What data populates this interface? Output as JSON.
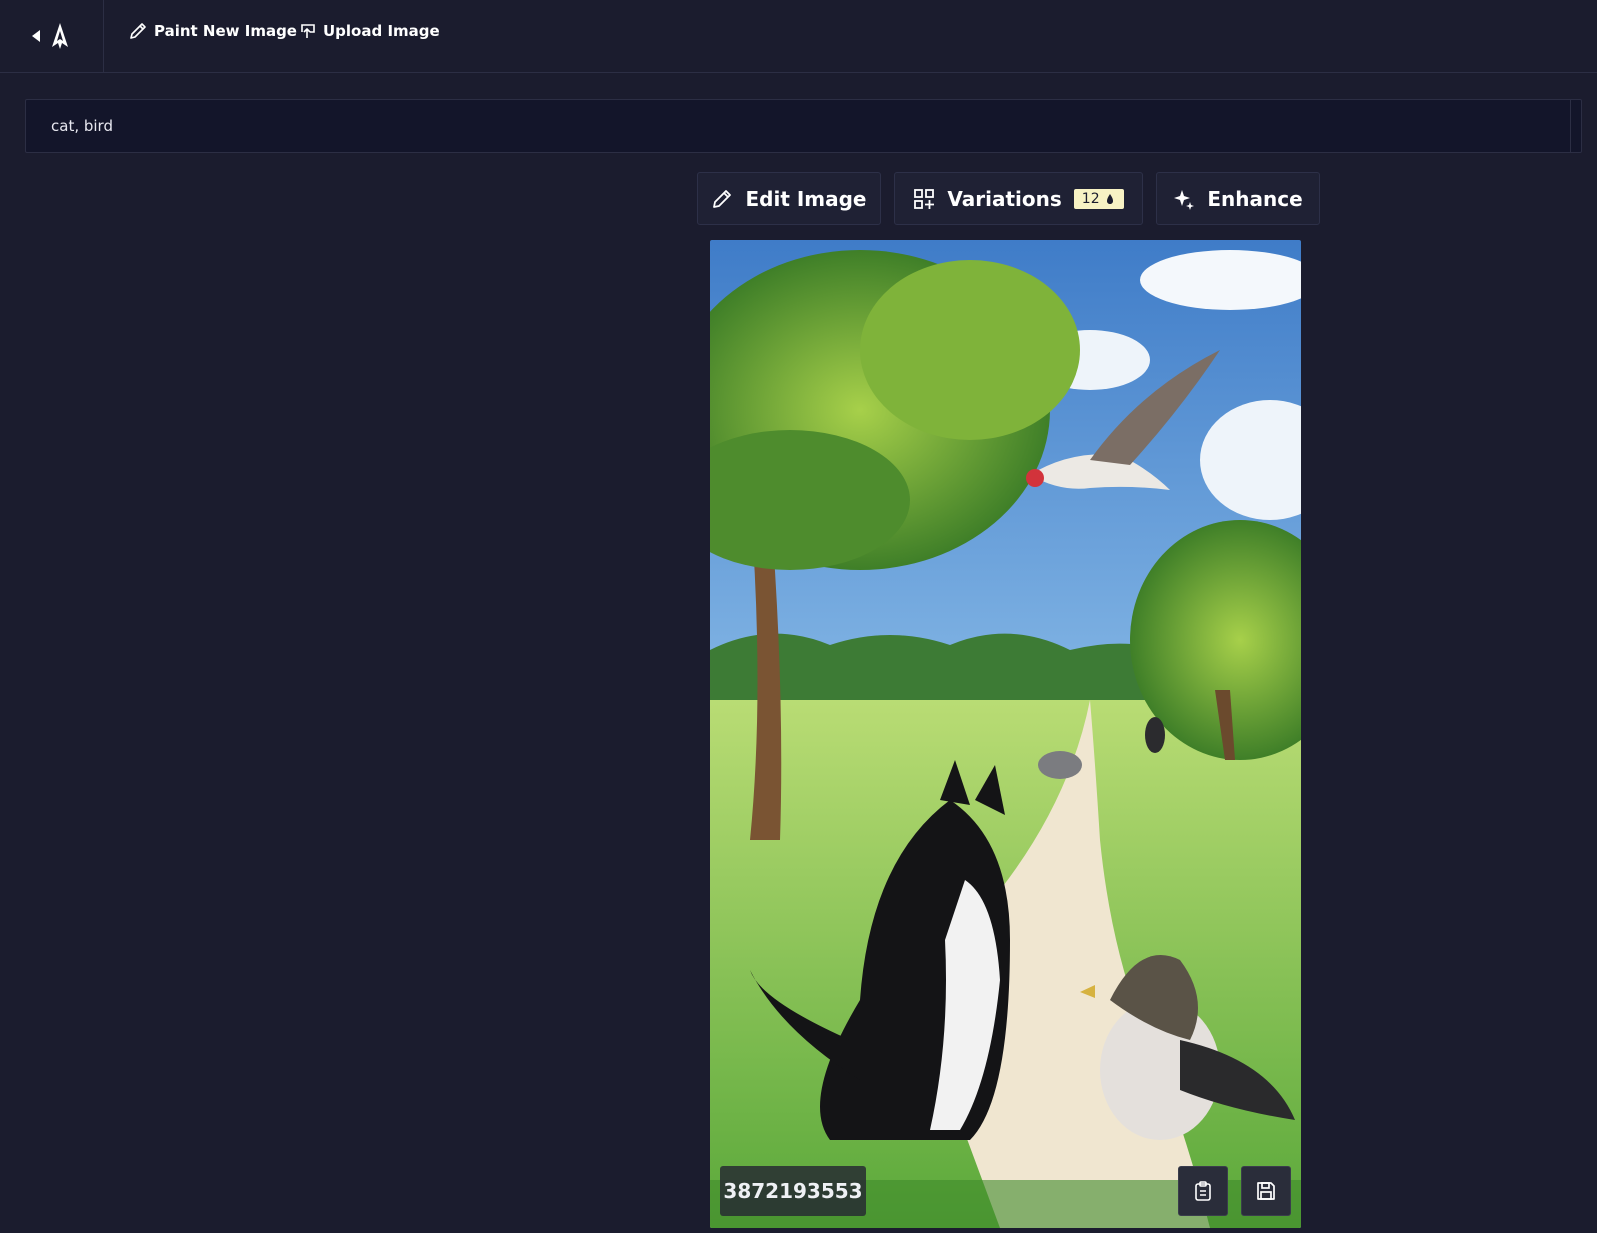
{
  "topbar": {
    "paint_label": "Paint New Image",
    "upload_label": "Upload Image"
  },
  "prompt": {
    "value": "cat, bird"
  },
  "actions": {
    "edit_label": "Edit Image",
    "variations_label": "Variations",
    "variations_count": "12",
    "enhance_label": "Enhance"
  },
  "image": {
    "seed": "3872193553"
  },
  "colors": {
    "background": "#1b1c2e",
    "panel": "#13152a",
    "badge": "#f7f2c4"
  },
  "icons": [
    "back-arrow-icon",
    "logo-icon",
    "pencil-icon",
    "upload-icon",
    "variations-grid-icon",
    "credits-icon",
    "sparkle-icon",
    "clipboard-icon",
    "save-icon"
  ]
}
